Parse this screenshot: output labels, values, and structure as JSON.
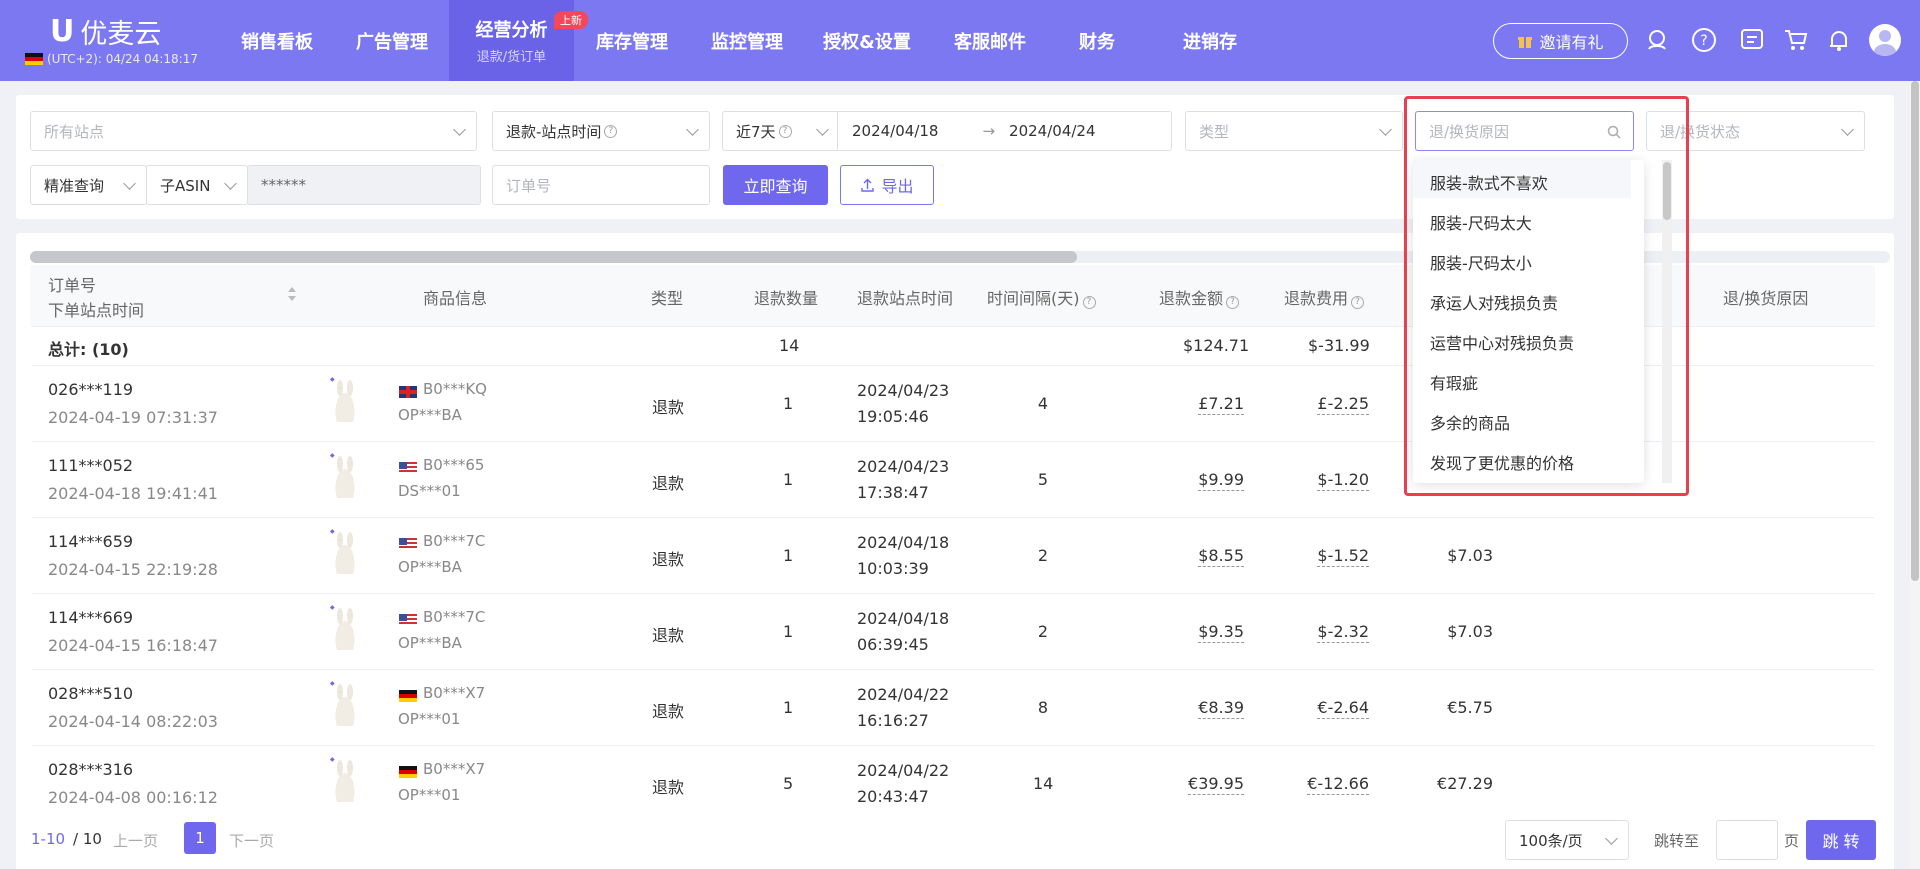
{
  "header": {
    "logo_text": "优麦云",
    "timezone": "(UTC+2): 04/24 04:18:17",
    "nav": [
      "销售看板",
      "广告管理",
      "经营分析",
      "库存管理",
      "监控管理",
      "授权&设置",
      "客服邮件",
      "财务",
      "进销存"
    ],
    "active_sub": "退款/货订单",
    "new_badge": "上新",
    "invite": "邀请有礼"
  },
  "filters": {
    "site_placeholder": "所有站点",
    "time_type": "退款-站点时间",
    "range_label": "近7天",
    "date_start": "2024/04/18",
    "date_end": "2024/04/24",
    "type_placeholder": "类型",
    "reason_placeholder": "退/换货原因",
    "status_placeholder": "退/换货状态",
    "query_mode": "精准查询",
    "asin_type": "子ASIN",
    "asin_value": "******",
    "order_placeholder": "订单号",
    "query_button": "立即查询",
    "export_button": "导出"
  },
  "table": {
    "headers": {
      "order": "订单号",
      "order_time": "下单站点时间",
      "product": "商品信息",
      "type": "类型",
      "qty": "退款数量",
      "refund_time": "退款站点时间",
      "interval": "时间间隔(天)",
      "amount": "退款金额",
      "fee": "退款费用",
      "reason": "退/换货原因"
    },
    "total": {
      "label": "总计: (10)",
      "qty": "14",
      "amount": "$124.71",
      "fee": "$-31.99"
    },
    "rows": [
      {
        "order": "026***119",
        "order_time": "2024-04-19 07:31:37",
        "flag": "uk",
        "asin": "B0***KQ",
        "sku": "OP***BA",
        "type": "退款",
        "qty": "1",
        "date": "2024/04/23",
        "time": "19:05:46",
        "interval": "4",
        "amount": "£7.21",
        "fee": "£-2.25",
        "net": ""
      },
      {
        "order": "111***052",
        "order_time": "2024-04-18 19:41:41",
        "flag": "us",
        "asin": "B0***65",
        "sku": "DS***01",
        "type": "退款",
        "qty": "1",
        "date": "2024/04/23",
        "time": "17:38:47",
        "interval": "5",
        "amount": "$9.99",
        "fee": "$-1.20",
        "net": ""
      },
      {
        "order": "114***659",
        "order_time": "2024-04-15 22:19:28",
        "flag": "us",
        "asin": "B0***7C",
        "sku": "OP***BA",
        "type": "退款",
        "qty": "1",
        "date": "2024/04/18",
        "time": "10:03:39",
        "interval": "2",
        "amount": "$8.55",
        "fee": "$-1.52",
        "net": "$7.03"
      },
      {
        "order": "114***669",
        "order_time": "2024-04-15 16:18:47",
        "flag": "us",
        "asin": "B0***7C",
        "sku": "OP***BA",
        "type": "退款",
        "qty": "1",
        "date": "2024/04/18",
        "time": "06:39:45",
        "interval": "2",
        "amount": "$9.35",
        "fee": "$-2.32",
        "net": "$7.03"
      },
      {
        "order": "028***510",
        "order_time": "2024-04-14 08:22:03",
        "flag": "de",
        "asin": "B0***X7",
        "sku": "OP***01",
        "type": "退款",
        "qty": "1",
        "date": "2024/04/22",
        "time": "16:16:27",
        "interval": "8",
        "amount": "€8.39",
        "fee": "€-2.64",
        "net": "€5.75"
      },
      {
        "order": "028***316",
        "order_time": "2024-04-08 00:16:12",
        "flag": "de",
        "asin": "B0***X7",
        "sku": "OP***01",
        "type": "退款",
        "qty": "5",
        "date": "2024/04/22",
        "time": "20:43:47",
        "interval": "14",
        "amount": "€39.95",
        "fee": "€-12.66",
        "net": "€27.29"
      }
    ]
  },
  "dropdown": {
    "items": [
      "服装-款式不喜欢",
      "服装-尺码太大",
      "服装-尺码太小",
      "承运人对残损负责",
      "运营中心对残损负责",
      "有瑕疵",
      "多余的商品",
      "发现了更优惠的价格"
    ]
  },
  "pagination": {
    "range": "1-10",
    "total": "/ 10",
    "prev": "上一页",
    "current": "1",
    "next": "下一页",
    "page_size": "100条/页",
    "jump_label": "跳转至",
    "page_unit": "页",
    "jump_button": "跳 转"
  },
  "colors": {
    "primary": "#7b78f2",
    "highlight": "#e8404f"
  }
}
